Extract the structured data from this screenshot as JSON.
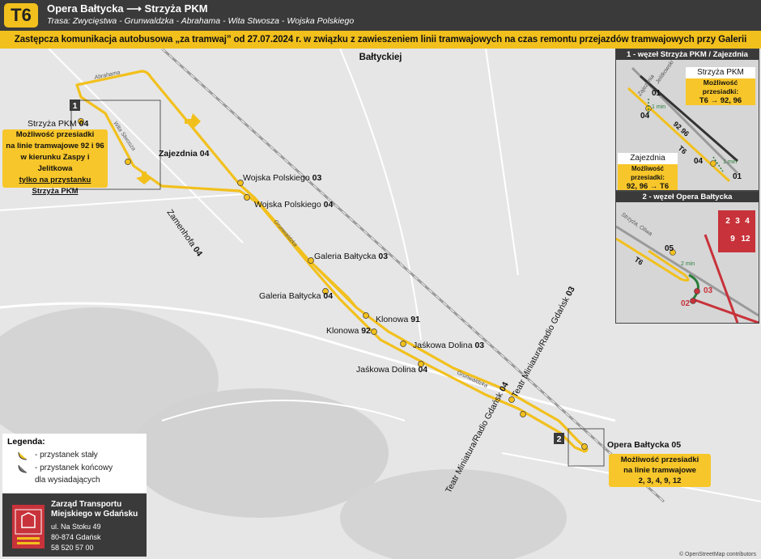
{
  "header": {
    "line": "T6",
    "title": "Opera Bałtycka ⟶ Strzyża PKM",
    "route": "Trasa: Zwycięstwa - Grunwaldzka - Abrahama - Wita Stwosza - Wojska Polskiego"
  },
  "notice": "Zastępcza komunikacja autobusowa „za tramwaj” od 27.07.2024 r. w związku z zawieszeniem linii tramwajowych na czas remontu przejazdów tramwajowych przy Galerii Bałtyckiej",
  "colors": {
    "route": "#f2c01d",
    "dark": "#3a3a3a",
    "tram": "#c8323a",
    "stop": "#2a7d3a"
  },
  "streets": {
    "abrahama": "Abrahama",
    "wita_stwosza": "Wita Stwosza",
    "zamenhofa": "Zamenhofa",
    "zamenhofa_no": "04",
    "grunwaldzka_1": "Grunwaldzka",
    "grunwaldzka_2": "Grunwaldzka"
  },
  "markers": {
    "m1": "1",
    "m2": "2"
  },
  "stops": {
    "strzyza_pkm": {
      "name": "Strzyża PKM",
      "no": "04"
    },
    "zajezdnia": {
      "name": "Zajezdnia",
      "no": "04"
    },
    "wojska_polskiego_03": {
      "name": "Wojska Polskiego",
      "no": "03"
    },
    "wojska_polskiego_04": {
      "name": "Wojska Polskiego",
      "no": "04"
    },
    "galeria_03": {
      "name": "Galeria Bałtycka",
      "no": "03"
    },
    "galeria_04": {
      "name": "Galeria Bałtycka",
      "no": "04"
    },
    "klonowa_91": {
      "name": "Klonowa",
      "no": "91"
    },
    "klonowa_92": {
      "name": "Klonowa",
      "no": "92"
    },
    "jaskowa_03": {
      "name": "Jaśkowa Dolina",
      "no": "03"
    },
    "jaskowa_04": {
      "name": "Jaśkowa Dolina",
      "no": "04"
    },
    "teatr_03": {
      "name": "Teatr Miniatura/Radio Gdańsk",
      "no": "03"
    },
    "teatr_04": {
      "name": "Teatr Miniatura/Radio Gdańsk",
      "no": "04"
    },
    "opera": {
      "name": "Opera Bałtycka",
      "no": "05"
    }
  },
  "transfer_left": {
    "line1": "Możliwość przesiadki",
    "line2": "na linie tramwajowe 92 i 96",
    "line3": "w kierunku Zaspy i Jelitkowa",
    "line4": "tylko na przystanku",
    "line5": "Strzyża PKM"
  },
  "transfer_opera": {
    "line1": "Możliwość przesiadki",
    "line2": "na linie tramwajowe",
    "line3": "2, 3, 4, 9, 12"
  },
  "inset1": {
    "title": "1 - węzeł Strzyża PKM / Zajezdnia",
    "s1": "Strzyża PKM",
    "s1_transfer_a": "Możliwość przesiadki:",
    "s1_transfer_b": "T6 → 92, 96",
    "s2": "Zajezdnia",
    "s2_transfer_a": "Możliwość przesiadki:",
    "s2_transfer_b": "92, 96 → T6",
    "n01a": "01",
    "n04a": "04",
    "n04b": "04",
    "n01b": "01",
    "tram_label": "92 96",
    "bus_label": "T6",
    "walk1": "1 min",
    "walk2": "1 min",
    "street_a": "Jelitkowski",
    "street_b": "Zajezdnia"
  },
  "inset2": {
    "title": "2 - węzeł Opera Bałtycka",
    "n05": "05",
    "n03": "03",
    "n02": "02",
    "walk": "2 min",
    "street_a": "Strzyża, Oliwa",
    "bus_label": "T6",
    "tram_a": "2",
    "tram_b": "3",
    "tram_c": "4",
    "tram_d": "9",
    "tram_e": "12"
  },
  "legend": {
    "title": "Legenda:",
    "row1": "- przystanek stały",
    "row2": "- przystanek końcowy",
    "row3": "dla wysiadających"
  },
  "ztm": {
    "name1": "Zarząd Transportu",
    "name2": "Miejskiego w Gdańsku",
    "addr1": "ul. Na Stoku 49",
    "addr2": "80-874 Gdańsk",
    "phone": "58 520 57 00"
  },
  "credit": "© OpenStreetMap contributors"
}
